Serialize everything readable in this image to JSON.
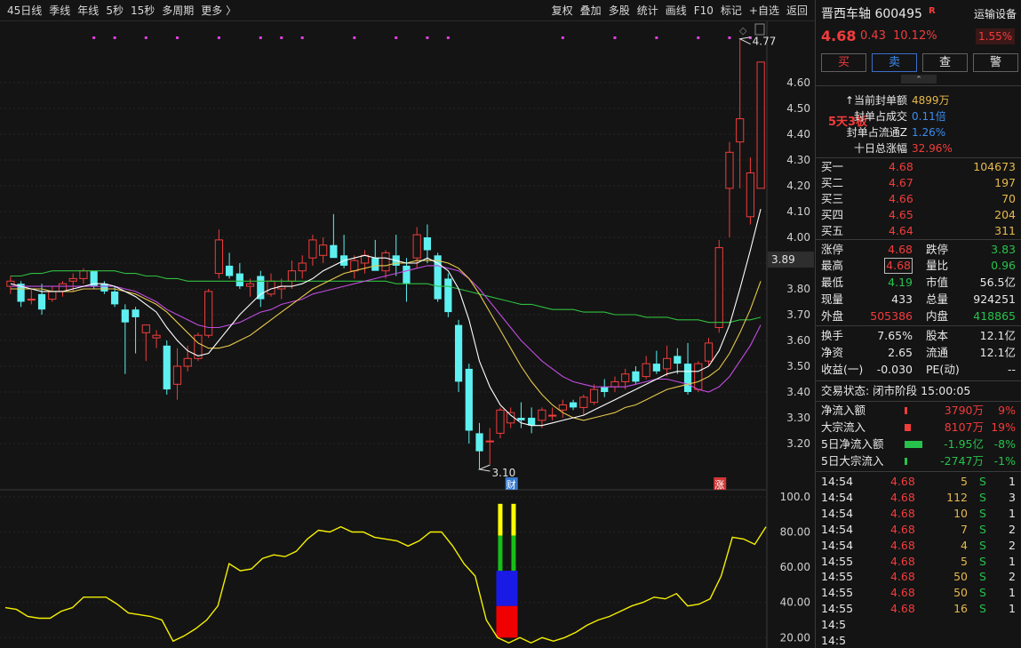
{
  "toolbar": {
    "left": [
      "45日线",
      "季线",
      "年线",
      "5秒",
      "15秒",
      "多周期",
      "更多 〉"
    ],
    "right": [
      "复权",
      "叠加",
      "多股",
      "统计",
      "画线",
      "F10",
      "标记",
      "+自选",
      "返回"
    ]
  },
  "chart_data": [
    {
      "type": "candlestick",
      "y_ticks": [
        "4.60",
        "4.50",
        "4.40",
        "4.30",
        "4.20",
        "4.10",
        "4.00",
        "3.90",
        "3.80",
        "3.70",
        "3.60",
        "3.50",
        "3.40",
        "3.30",
        "3.20"
      ],
      "ylim": [
        3.12,
        4.77
      ],
      "current_price_label": "3.89",
      "high_label": "4.77",
      "low_label": "3.10",
      "markers": [
        {
          "text": "财"
        },
        {
          "text": "涨"
        }
      ],
      "candles": [
        {
          "o": 3.81,
          "h": 3.85,
          "l": 3.78,
          "c": 3.83
        },
        {
          "o": 3.82,
          "h": 3.83,
          "l": 3.73,
          "c": 3.75
        },
        {
          "o": 3.76,
          "h": 3.8,
          "l": 3.74,
          "c": 3.76
        },
        {
          "o": 3.78,
          "h": 3.82,
          "l": 3.7,
          "c": 3.72
        },
        {
          "o": 3.76,
          "h": 3.81,
          "l": 3.75,
          "c": 3.79
        },
        {
          "o": 3.79,
          "h": 3.83,
          "l": 3.77,
          "c": 3.82
        },
        {
          "o": 3.83,
          "h": 3.86,
          "l": 3.79,
          "c": 3.84
        },
        {
          "o": 3.84,
          "h": 3.88,
          "l": 3.82,
          "c": 3.87
        },
        {
          "o": 3.87,
          "h": 3.87,
          "l": 3.8,
          "c": 3.81
        },
        {
          "o": 3.82,
          "h": 3.83,
          "l": 3.78,
          "c": 3.79
        },
        {
          "o": 3.79,
          "h": 3.81,
          "l": 3.73,
          "c": 3.74
        },
        {
          "o": 3.72,
          "h": 3.74,
          "l": 3.47,
          "c": 3.67
        },
        {
          "o": 3.72,
          "h": 3.73,
          "l": 3.55,
          "c": 3.69
        },
        {
          "o": 3.63,
          "h": 3.65,
          "l": 3.52,
          "c": 3.66
        },
        {
          "o": 3.61,
          "h": 3.64,
          "l": 3.57,
          "c": 3.62
        },
        {
          "o": 3.58,
          "h": 3.6,
          "l": 3.39,
          "c": 3.41
        },
        {
          "o": 3.43,
          "h": 3.57,
          "l": 3.37,
          "c": 3.5
        },
        {
          "o": 3.5,
          "h": 3.58,
          "l": 3.48,
          "c": 3.53
        },
        {
          "o": 3.53,
          "h": 3.63,
          "l": 3.52,
          "c": 3.62
        },
        {
          "o": 3.62,
          "h": 3.8,
          "l": 3.61,
          "c": 3.79
        },
        {
          "o": 3.86,
          "h": 4.03,
          "l": 3.84,
          "c": 3.99
        },
        {
          "o": 3.89,
          "h": 3.94,
          "l": 3.84,
          "c": 3.85
        },
        {
          "o": 3.86,
          "h": 3.9,
          "l": 3.8,
          "c": 3.81
        },
        {
          "o": 3.81,
          "h": 3.84,
          "l": 3.77,
          "c": 3.82
        },
        {
          "o": 3.85,
          "h": 3.87,
          "l": 3.73,
          "c": 3.76
        },
        {
          "o": 3.78,
          "h": 3.86,
          "l": 3.77,
          "c": 3.83
        },
        {
          "o": 3.8,
          "h": 3.84,
          "l": 3.76,
          "c": 3.81
        },
        {
          "o": 3.83,
          "h": 3.91,
          "l": 3.8,
          "c": 3.87
        },
        {
          "o": 3.87,
          "h": 3.93,
          "l": 3.84,
          "c": 3.9
        },
        {
          "o": 3.92,
          "h": 4.01,
          "l": 3.89,
          "c": 3.99
        },
        {
          "o": 3.93,
          "h": 4.0,
          "l": 3.9,
          "c": 3.97
        },
        {
          "o": 3.97,
          "h": 4.09,
          "l": 3.93,
          "c": 3.92
        },
        {
          "o": 3.93,
          "h": 4.01,
          "l": 3.88,
          "c": 3.89
        },
        {
          "o": 3.87,
          "h": 3.93,
          "l": 3.84,
          "c": 3.91
        },
        {
          "o": 3.9,
          "h": 3.95,
          "l": 3.86,
          "c": 3.93
        },
        {
          "o": 3.92,
          "h": 3.99,
          "l": 3.88,
          "c": 3.87
        },
        {
          "o": 3.87,
          "h": 3.95,
          "l": 3.84,
          "c": 3.94
        },
        {
          "o": 3.93,
          "h": 4.01,
          "l": 3.85,
          "c": 3.89
        },
        {
          "o": 3.89,
          "h": 3.92,
          "l": 3.75,
          "c": 3.82
        },
        {
          "o": 3.92,
          "h": 4.04,
          "l": 3.88,
          "c": 4.01
        },
        {
          "o": 4.0,
          "h": 4.05,
          "l": 3.9,
          "c": 3.95
        },
        {
          "o": 3.93,
          "h": 3.94,
          "l": 3.75,
          "c": 3.76
        },
        {
          "o": 3.84,
          "h": 3.86,
          "l": 3.69,
          "c": 3.71
        },
        {
          "o": 3.66,
          "h": 3.68,
          "l": 3.4,
          "c": 3.44
        },
        {
          "o": 3.49,
          "h": 3.51,
          "l": 3.2,
          "c": 3.25
        },
        {
          "o": 3.24,
          "h": 3.28,
          "l": 3.1,
          "c": 3.17
        },
        {
          "o": 3.21,
          "h": 3.26,
          "l": 3.12,
          "c": 3.21
        },
        {
          "o": 3.24,
          "h": 3.34,
          "l": 3.22,
          "c": 3.33
        },
        {
          "o": 3.28,
          "h": 3.34,
          "l": 3.26,
          "c": 3.32
        },
        {
          "o": 3.3,
          "h": 3.36,
          "l": 3.26,
          "c": 3.29
        },
        {
          "o": 3.3,
          "h": 3.34,
          "l": 3.24,
          "c": 3.27
        },
        {
          "o": 3.29,
          "h": 3.34,
          "l": 3.26,
          "c": 3.33
        },
        {
          "o": 3.31,
          "h": 3.34,
          "l": 3.29,
          "c": 3.31
        },
        {
          "o": 3.33,
          "h": 3.37,
          "l": 3.3,
          "c": 3.35
        },
        {
          "o": 3.36,
          "h": 3.37,
          "l": 3.33,
          "c": 3.34
        },
        {
          "o": 3.34,
          "h": 3.39,
          "l": 3.31,
          "c": 3.38
        },
        {
          "o": 3.36,
          "h": 3.43,
          "l": 3.35,
          "c": 3.41
        },
        {
          "o": 3.42,
          "h": 3.45,
          "l": 3.38,
          "c": 3.4
        },
        {
          "o": 3.42,
          "h": 3.46,
          "l": 3.4,
          "c": 3.44
        },
        {
          "o": 3.44,
          "h": 3.49,
          "l": 3.41,
          "c": 3.47
        },
        {
          "o": 3.48,
          "h": 3.5,
          "l": 3.43,
          "c": 3.44
        },
        {
          "o": 3.46,
          "h": 3.54,
          "l": 3.45,
          "c": 3.51
        },
        {
          "o": 3.51,
          "h": 3.56,
          "l": 3.47,
          "c": 3.48
        },
        {
          "o": 3.49,
          "h": 3.58,
          "l": 3.46,
          "c": 3.53
        },
        {
          "o": 3.54,
          "h": 3.57,
          "l": 3.47,
          "c": 3.51
        },
        {
          "o": 3.51,
          "h": 3.59,
          "l": 3.39,
          "c": 3.4
        },
        {
          "o": 3.41,
          "h": 3.52,
          "l": 3.4,
          "c": 3.51
        },
        {
          "o": 3.52,
          "h": 3.61,
          "l": 3.5,
          "c": 3.59
        },
        {
          "o": 3.65,
          "h": 3.99,
          "l": 3.63,
          "c": 3.96
        },
        {
          "o": 4.19,
          "h": 4.37,
          "l": 4.0,
          "c": 4.33
        },
        {
          "o": 4.37,
          "h": 4.77,
          "l": 4.19,
          "c": 4.46
        },
        {
          "o": 4.08,
          "h": 4.31,
          "l": 4.05,
          "c": 4.25
        },
        {
          "o": 4.19,
          "h": 4.68,
          "l": 4.19,
          "c": 4.68
        }
      ],
      "ma_white": [
        3.82,
        3.81,
        3.8,
        3.79,
        3.79,
        3.79,
        3.8,
        3.81,
        3.82,
        3.82,
        3.81,
        3.79,
        3.77,
        3.74,
        3.71,
        3.65,
        3.6,
        3.56,
        3.54,
        3.55,
        3.6,
        3.65,
        3.7,
        3.74,
        3.78,
        3.8,
        3.81,
        3.81,
        3.82,
        3.84,
        3.87,
        3.89,
        3.91,
        3.92,
        3.93,
        3.92,
        3.92,
        3.91,
        3.9,
        3.9,
        3.92,
        3.9,
        3.87,
        3.8,
        3.68,
        3.52,
        3.42,
        3.35,
        3.31,
        3.28,
        3.27,
        3.27,
        3.28,
        3.29,
        3.3,
        3.31,
        3.33,
        3.35,
        3.37,
        3.39,
        3.41,
        3.43,
        3.45,
        3.47,
        3.48,
        3.48,
        3.48,
        3.5,
        3.56,
        3.66,
        3.8,
        3.95,
        4.11
      ],
      "ma_yellow": [
        3.8,
        3.8,
        3.8,
        3.8,
        3.79,
        3.79,
        3.79,
        3.8,
        3.8,
        3.8,
        3.8,
        3.79,
        3.78,
        3.76,
        3.74,
        3.71,
        3.67,
        3.63,
        3.59,
        3.57,
        3.57,
        3.58,
        3.6,
        3.62,
        3.65,
        3.68,
        3.71,
        3.74,
        3.77,
        3.8,
        3.82,
        3.84,
        3.86,
        3.87,
        3.88,
        3.89,
        3.89,
        3.9,
        3.9,
        3.91,
        3.91,
        3.91,
        3.9,
        3.88,
        3.84,
        3.78,
        3.71,
        3.64,
        3.57,
        3.5,
        3.44,
        3.39,
        3.35,
        3.32,
        3.3,
        3.29,
        3.3,
        3.31,
        3.32,
        3.34,
        3.35,
        3.37,
        3.39,
        3.41,
        3.42,
        3.43,
        3.44,
        3.46,
        3.49,
        3.55,
        3.63,
        3.72,
        3.83
      ],
      "ma_purple": [
        3.81,
        3.81,
        3.81,
        3.81,
        3.81,
        3.81,
        3.81,
        3.81,
        3.81,
        3.81,
        3.81,
        3.8,
        3.79,
        3.77,
        3.75,
        3.72,
        3.7,
        3.68,
        3.66,
        3.65,
        3.65,
        3.66,
        3.67,
        3.69,
        3.71,
        3.72,
        3.74,
        3.75,
        3.76,
        3.78,
        3.79,
        3.8,
        3.81,
        3.82,
        3.83,
        3.84,
        3.85,
        3.86,
        3.87,
        3.88,
        3.89,
        3.89,
        3.88,
        3.87,
        3.84,
        3.8,
        3.75,
        3.7,
        3.65,
        3.6,
        3.56,
        3.52,
        3.49,
        3.46,
        3.44,
        3.43,
        3.42,
        3.42,
        3.42,
        3.42,
        3.43,
        3.44,
        3.45,
        3.45,
        3.44,
        3.43,
        3.41,
        3.4,
        3.42,
        3.46,
        3.52,
        3.58,
        3.66
      ],
      "ma_green": [
        3.85,
        3.85,
        3.86,
        3.86,
        3.87,
        3.87,
        3.87,
        3.87,
        3.87,
        3.87,
        3.87,
        3.86,
        3.86,
        3.85,
        3.85,
        3.84,
        3.84,
        3.83,
        3.83,
        3.83,
        3.83,
        3.83,
        3.83,
        3.83,
        3.83,
        3.83,
        3.83,
        3.83,
        3.83,
        3.83,
        3.83,
        3.83,
        3.83,
        3.83,
        3.83,
        3.83,
        3.83,
        3.82,
        3.82,
        3.82,
        3.82,
        3.81,
        3.81,
        3.8,
        3.79,
        3.78,
        3.77,
        3.76,
        3.75,
        3.74,
        3.74,
        3.73,
        3.72,
        3.72,
        3.72,
        3.71,
        3.71,
        3.71,
        3.7,
        3.7,
        3.7,
        3.69,
        3.69,
        3.69,
        3.68,
        3.68,
        3.68,
        3.67,
        3.67,
        3.67,
        3.68,
        3.68,
        3.69
      ]
    },
    {
      "type": "line",
      "y_ticks": [
        "100.0",
        "80.00",
        "60.00",
        "40.00",
        "20.00"
      ],
      "ylim": [
        15,
        105
      ],
      "values": [
        37,
        36,
        32,
        31,
        31,
        35,
        37,
        43,
        43,
        43,
        39,
        34,
        33,
        32,
        30,
        18,
        21,
        25,
        30,
        38,
        62,
        58,
        59,
        65,
        67,
        66,
        69,
        76,
        81,
        80,
        83,
        80,
        80,
        77,
        76,
        75,
        72,
        75,
        80,
        80,
        72,
        62,
        55,
        30,
        20,
        17,
        20,
        17,
        20,
        18,
        20,
        23,
        27,
        30,
        32,
        35,
        38,
        40,
        43,
        42,
        45,
        38,
        39,
        42,
        55,
        77,
        76,
        73,
        83
      ],
      "bars": [
        {
          "color": "#f00000",
          "from": 20,
          "to": 38
        },
        {
          "color": "#1a1ae6",
          "from": 38,
          "to": 58
        },
        {
          "color": "#16c016",
          "from": 58,
          "to": 78
        },
        {
          "color": "#ffff00",
          "from": 78,
          "to": 96
        }
      ]
    }
  ],
  "stock": {
    "name_code": "晋西车轴 600495",
    "r_badge": "R",
    "sector": "运输设备",
    "price": "4.68",
    "change": "0.43",
    "pct": "10.12%",
    "sector_pct": "1.55%"
  },
  "buttons": [
    "买",
    "卖",
    "查",
    "警"
  ],
  "collapse_glyph": "⌃",
  "seal": {
    "badge": "5天3板",
    "rows": [
      {
        "label": "↑当前封单额",
        "value": "4899万"
      },
      {
        "label": "封单占成交",
        "value": "0.11倍"
      },
      {
        "label": "封单占流通Z",
        "value": "1.26%"
      },
      {
        "label": "十日总涨幅",
        "value": "32.96%"
      }
    ]
  },
  "bids": [
    {
      "label": "买一",
      "price": "4.68",
      "vol": "104673"
    },
    {
      "label": "买二",
      "price": "4.67",
      "vol": "197"
    },
    {
      "label": "买三",
      "price": "4.66",
      "vol": "70"
    },
    {
      "label": "买四",
      "price": "4.65",
      "vol": "204"
    },
    {
      "label": "买五",
      "price": "4.64",
      "vol": "311"
    }
  ],
  "quote": {
    "zt_l": "涨停",
    "zt_v": "4.68",
    "dt_l": "跌停",
    "dt_v": "3.83",
    "high_l": "最高",
    "high_v": "4.68",
    "lb_l": "量比",
    "lb_v": "0.96",
    "low_l": "最低",
    "low_v": "4.19",
    "mcap_l": "市值",
    "mcap_v": "56.5亿",
    "cur_l": "现量",
    "cur_v": "433",
    "tot_l": "总量",
    "tot_v": "924251",
    "out_l": "外盘",
    "out_v": "505386",
    "in_l": "内盘",
    "in_v": "418865",
    "turn_l": "换手",
    "turn_v": "7.65%",
    "cap_l": "股本",
    "cap_v": "12.1亿",
    "nav_l": "净资",
    "nav_v": "2.65",
    "flt_l": "流通",
    "flt_v": "12.1亿",
    "eps_l": "收益(一)",
    "eps_v": "-0.030",
    "pe_l": "PE(动)",
    "pe_v": "--"
  },
  "trade_status": "交易状态: 闭市阶段 15:00:05",
  "flows": [
    {
      "label": "净流入额",
      "value": "3790万",
      "pct": "9%",
      "color": "#f23c3c",
      "bar": 0.07
    },
    {
      "label": "大宗流入",
      "value": "8107万",
      "pct": "19%",
      "color": "#f23c3c",
      "bar": 0.18
    },
    {
      "label": "5日净流入额",
      "value": "-1.95亿",
      "pct": "-8%",
      "color": "#27c24c",
      "bar": 0.5
    },
    {
      "label": "5日大宗流入",
      "value": "-2747万",
      "pct": "-1%",
      "color": "#27c24c",
      "bar": 0.05
    }
  ],
  "ticks": [
    {
      "time": "14:54",
      "price": "4.68",
      "vol": "5",
      "side": "S",
      "n": "1"
    },
    {
      "time": "14:54",
      "price": "4.68",
      "vol": "112",
      "side": "S",
      "n": "3"
    },
    {
      "time": "14:54",
      "price": "4.68",
      "vol": "10",
      "side": "S",
      "n": "1"
    },
    {
      "time": "14:54",
      "price": "4.68",
      "vol": "7",
      "side": "S",
      "n": "2"
    },
    {
      "time": "14:54",
      "price": "4.68",
      "vol": "4",
      "side": "S",
      "n": "2"
    },
    {
      "time": "14:55",
      "price": "4.68",
      "vol": "5",
      "side": "S",
      "n": "1"
    },
    {
      "time": "14:55",
      "price": "4.68",
      "vol": "50",
      "side": "S",
      "n": "2"
    },
    {
      "time": "14:55",
      "price": "4.68",
      "vol": "50",
      "side": "S",
      "n": "1"
    },
    {
      "time": "14:55",
      "price": "4.68",
      "vol": "16",
      "side": "S",
      "n": "1"
    },
    {
      "time": "14:5",
      "price": "",
      "vol": "",
      "side": "",
      "n": ""
    },
    {
      "time": "14:5",
      "price": "",
      "vol": "",
      "side": "",
      "n": ""
    }
  ],
  "colors": {
    "up": "#f23c3c",
    "down": "#5ef0f0",
    "ma_white": "#ffffff",
    "ma_yellow": "#e6c84a",
    "ma_purple": "#c24ce0",
    "ma_green": "#2fbf3f",
    "osc": "#f5f000"
  }
}
